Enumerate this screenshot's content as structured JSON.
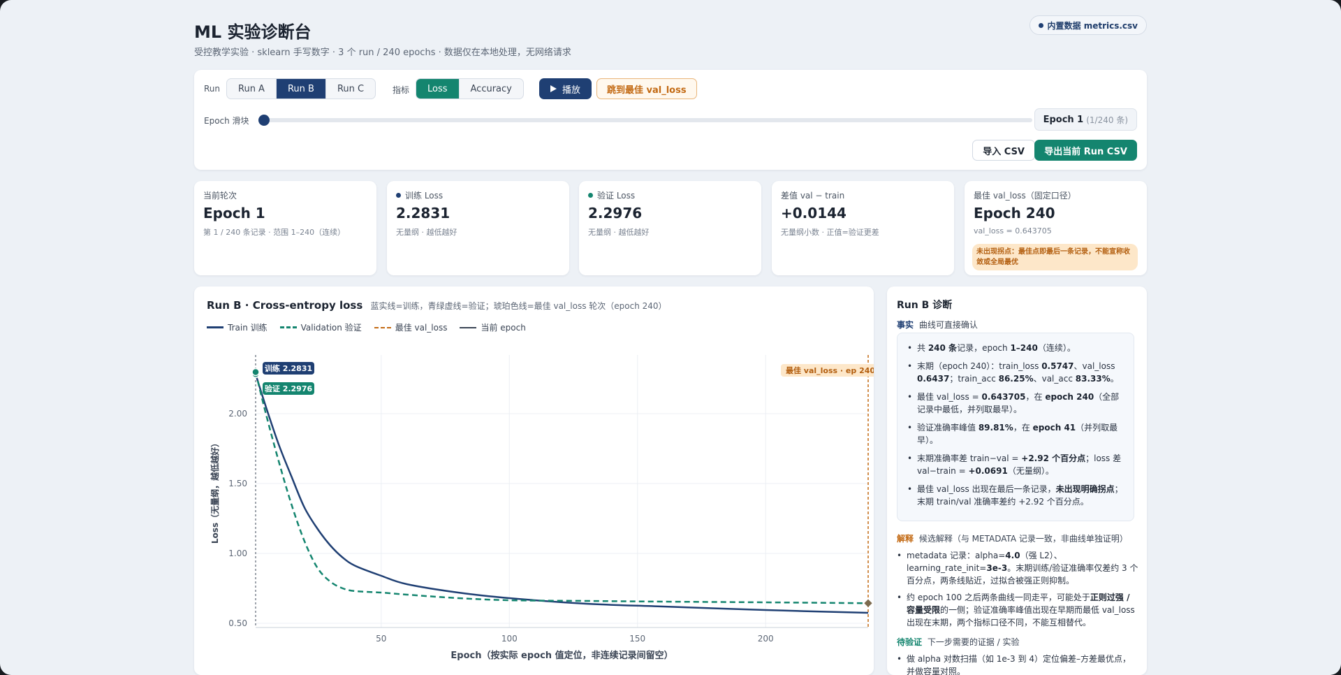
{
  "header": {
    "title": "ML 实验诊断台",
    "subtitle": "受控教学实验 · sklearn 手写数字 · 3 个 run / 240 epochs · 数据仅在本地处理，无网络请求",
    "data_pill": "内置数据 metrics.csv"
  },
  "controls": {
    "run_label": "Run",
    "runs": [
      "Run A",
      "Run B",
      "Run C"
    ],
    "active_run": "Run B",
    "metric_label": "指标",
    "metrics": [
      "Loss",
      "Accuracy"
    ],
    "active_metric": "Loss",
    "play_label": "播放",
    "jump_label": "跳到最佳 val_loss",
    "slider_label": "Epoch 滑块",
    "slider_value_fraction": 0.0,
    "epoch_display": "Epoch 1",
    "epoch_display_sub": "(1/240 条)",
    "import_label": "导入 CSV",
    "export_label": "导出当前 Run CSV"
  },
  "stats": [
    {
      "label": "当前轮次",
      "value": "Epoch 1",
      "sub": "第 1 / 240 条记录 · 范围 1–240（连续）",
      "dot": ""
    },
    {
      "label": "训练 Loss",
      "value": "2.2831",
      "sub": "无量纲 · 越低越好",
      "dot": "#1f3f73"
    },
    {
      "label": "验证 Loss",
      "value": "2.2976",
      "sub": "无量纲 · 越低越好",
      "dot": "#14856f"
    },
    {
      "label": "差值 val − train",
      "value": "+0.0144",
      "sub": "无量纲小数 · 正值=验证更差",
      "dot": ""
    },
    {
      "label": "最佳 val_loss（固定口径）",
      "value": "Epoch 240",
      "sub": "val_loss = 0.643705",
      "dot": "",
      "warning": "未出现拐点：最佳点即最后一条记录，不能宣称收敛或全局最优"
    }
  ],
  "chart": {
    "title": "Run B · Cross-entropy loss",
    "note": "蓝实线=训练，青绿虚线=验证；琥珀色线=最佳 val_loss 轮次（epoch 240）",
    "legend": [
      "Train 训练",
      "Validation 验证",
      "最佳 val_loss",
      "当前 epoch"
    ],
    "train_tag": "训练 2.2831",
    "val_tag": "验证 2.2976",
    "best_tag": "最佳 val_loss · ep 240",
    "xlabel": "Epoch（按实际 epoch 值定位，非连续记录间留空）",
    "ylabel": "Loss（无量纲，越低越好）",
    "colors": {
      "train": "#1f3f73",
      "val": "#14856f",
      "best": "#c36a14",
      "current": "#3a4454"
    }
  },
  "chart_data": {
    "type": "line",
    "x_ticks": [
      50,
      100,
      150,
      200
    ],
    "y_ticks": [
      0.5,
      1.0,
      1.5,
      2.0
    ],
    "y_tick_labels": [
      "0.50",
      "1.00",
      "1.50",
      "2.00"
    ],
    "xlim": [
      1,
      240
    ],
    "ylim": [
      0.47,
      2.42
    ],
    "current_epoch": 1,
    "best_epoch": 240,
    "series": [
      {
        "name": "Train 训练",
        "x": [
          1,
          5,
          10,
          15,
          20,
          25,
          30,
          35,
          40,
          50,
          60,
          80,
          100,
          130,
          160,
          200,
          240
        ],
        "values": [
          2.2831,
          2.05,
          1.78,
          1.55,
          1.33,
          1.18,
          1.06,
          0.97,
          0.91,
          0.84,
          0.78,
          0.72,
          0.68,
          0.64,
          0.62,
          0.595,
          0.5747
        ]
      },
      {
        "name": "Validation 验证",
        "x": [
          1,
          5,
          10,
          15,
          20,
          25,
          30,
          35,
          40,
          50,
          60,
          80,
          100,
          130,
          160,
          200,
          240
        ],
        "values": [
          2.2976,
          2.0,
          1.66,
          1.35,
          1.09,
          0.9,
          0.8,
          0.75,
          0.73,
          0.72,
          0.705,
          0.68,
          0.665,
          0.66,
          0.655,
          0.65,
          0.6437
        ]
      }
    ]
  },
  "diagnosis": {
    "title": "Run B 诊断",
    "facts_tag": "事实",
    "facts_head": "曲线可直接确认",
    "facts": [
      "共 **240 条**记录，epoch **1–240**（连续）。",
      "末期（epoch 240）：train_loss **0.5747**、val_loss **0.6437**；train_acc **86.25%**、val_acc **83.33%**。",
      "最佳 val_loss = **0.643705**，在 **epoch 240**（全部记录中最低，并列取最早）。",
      "验证准确率峰值 **89.81%**，在 **epoch 41**（并列取最早）。",
      "末期准确率差 train−val = **+2.92 个百分点**；loss 差 val−train = **+0.0691**（无量纲）。",
      "最佳 val_loss 出现在最后一条记录，**未出现明确拐点**；末期 train/val 准确率差约 +2.92 个百分点。"
    ],
    "interp_tag": "解释",
    "interp_head": "候选解释（与 METADATA 记录一致，非曲线单独证明）",
    "interp": [
      "metadata 记录：alpha=**4.0**（强 L2）、learning_rate_init=**3e-3**。末期训练/验证准确率仅差约 3 个百分点，两条线贴近，过拟合被强正则抑制。",
      "约 epoch 100 之后两条曲线一同走平，可能处于**正则过强 / 容量受限**的一侧；验证准确率峰值出现在早期而最低 val_loss 出现在末期，两个指标口径不同，不能互相替代。"
    ],
    "todo_tag": "待验证",
    "todo_head": "下一步需要的证据 / 实验",
    "todo": [
      "做 alpha 对数扫描（如 1e-3 到 4）定位偏差–方差最优点，并做容量对照。"
    ]
  }
}
